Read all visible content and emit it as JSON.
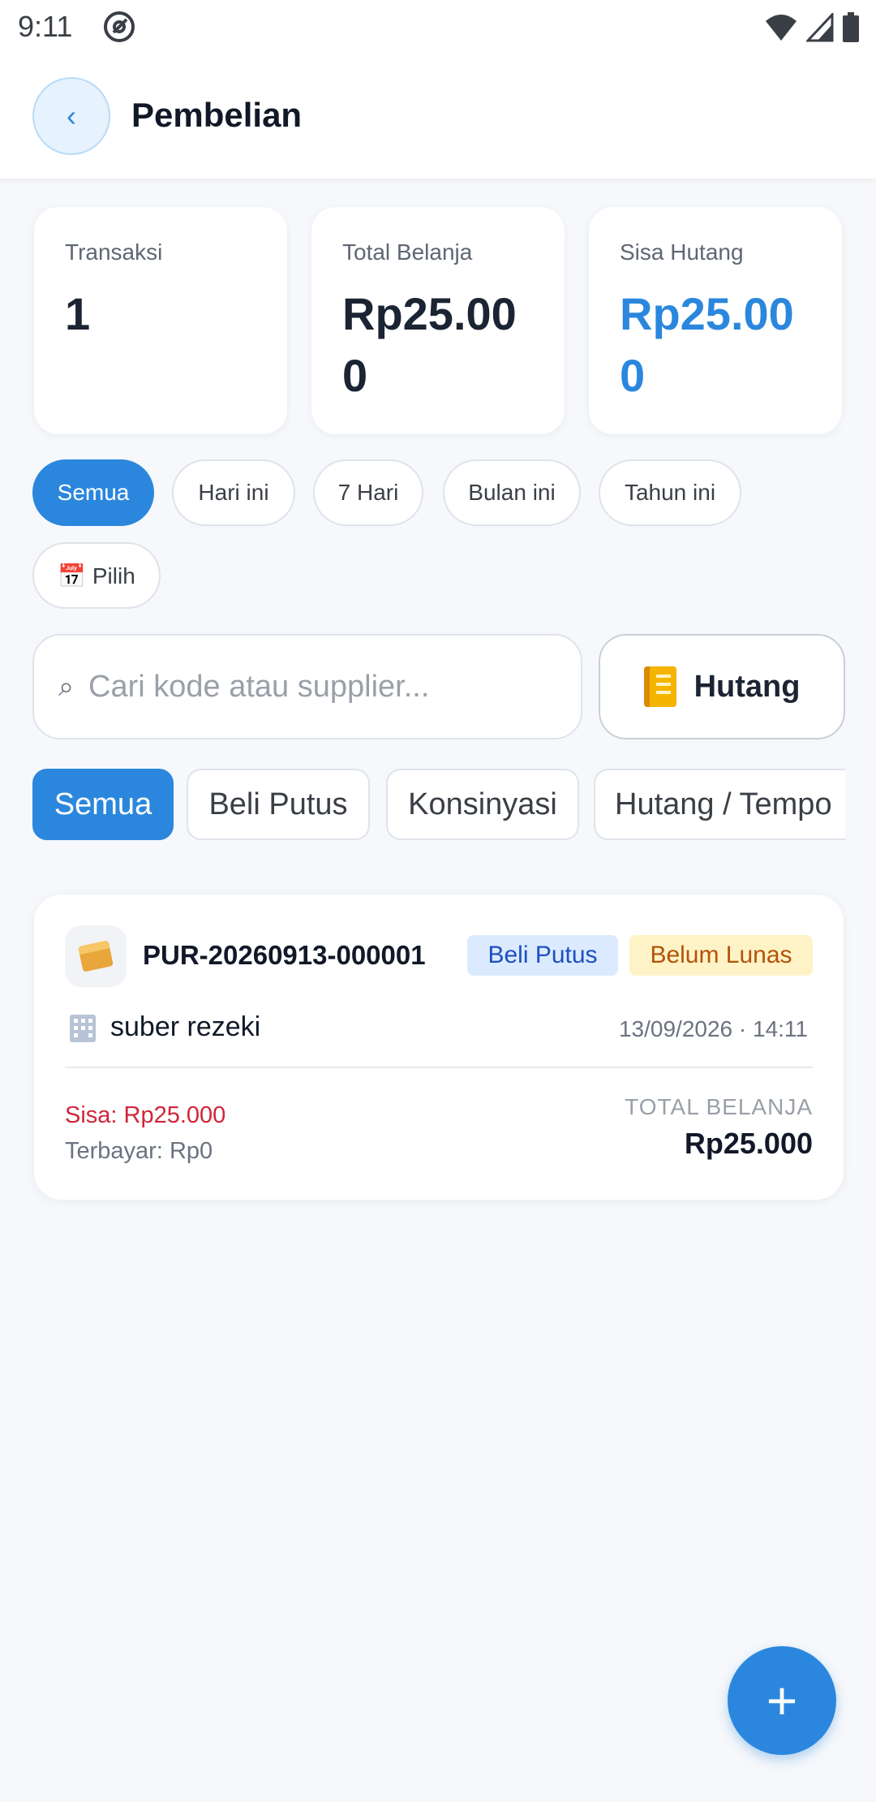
{
  "status_bar": {
    "time": "9:11"
  },
  "header": {
    "title": "Pembelian",
    "back_label": "‹"
  },
  "stats": [
    {
      "label": "Transaksi",
      "value": "1"
    },
    {
      "label": "Total Belanja",
      "value": "Rp25.000"
    },
    {
      "label": "Sisa Hutang",
      "value": "Rp25.000"
    }
  ],
  "date_filters": [
    {
      "label": "Semua",
      "active": true
    },
    {
      "label": "Hari ini"
    },
    {
      "label": "7 Hari"
    },
    {
      "label": "Bulan ini"
    },
    {
      "label": "Tahun ini"
    },
    {
      "label": "📅 Pilih"
    }
  ],
  "search": {
    "icon": "⌕",
    "placeholder": "Cari kode atau supplier..."
  },
  "hutang_button": {
    "label": "Hutang"
  },
  "type_tabs": [
    {
      "label": "Semua",
      "active": true
    },
    {
      "label": "Beli Putus"
    },
    {
      "label": "Konsinyasi"
    },
    {
      "label": "Hutang / Tempo"
    }
  ],
  "purchases": [
    {
      "code": "PUR-20260913-000001",
      "type_badge": "Beli Putus",
      "status_badge": "Belum Lunas",
      "supplier": "suber rezeki",
      "datetime": "13/09/2026 · 14:11",
      "remaining": "Sisa: Rp25.000",
      "paid": "Terbayar: Rp0",
      "total_label": "TOTAL BELANJA",
      "total_value": "Rp25.000"
    }
  ],
  "fab": {
    "label": "+"
  },
  "colors": {
    "accent": "#2b87dd",
    "danger": "#d1253a",
    "badge_blue": "#dbeafe",
    "badge_amber": "#fef3c7"
  }
}
